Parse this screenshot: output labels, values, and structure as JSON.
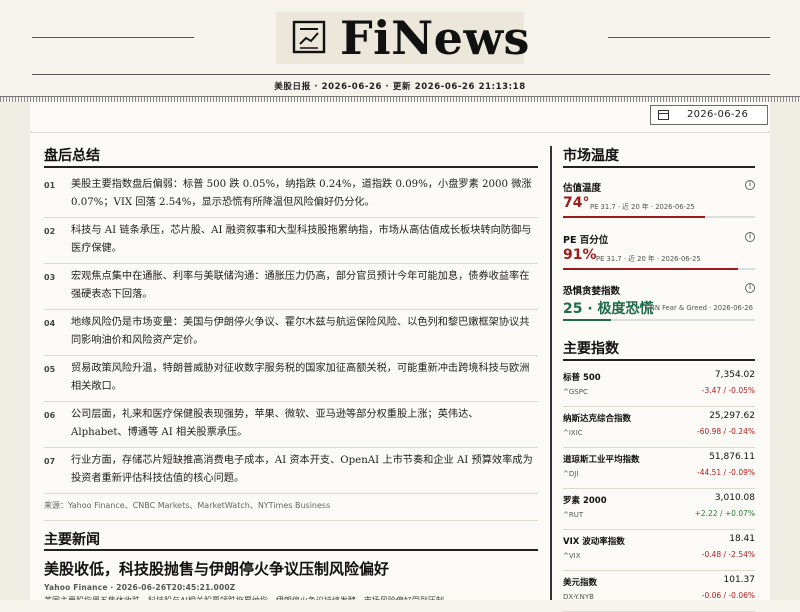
{
  "masthead": {
    "logo": "FiNews",
    "dateline": "美股日报 · 2026-06-26 · 更新 2026-06-26 21:13:18"
  },
  "date_picker": {
    "value": "2026-06-26"
  },
  "summary": {
    "title": "盘后总结",
    "items": [
      {
        "num": "01",
        "text": "美股主要指数盘后偏弱：标普 500 跌 0.05%，纳指跌 0.24%，道指跌 0.09%，小盘罗素 2000 微涨 0.07%；VIX 回落 2.54%，显示恐慌有所降温但风险偏好仍分化。"
      },
      {
        "num": "02",
        "text": "科技与 AI 链条承压，芯片股、AI 融资叙事和大型科技股拖累纳指，市场从高估值成长板块转向防御与医疗保健。"
      },
      {
        "num": "03",
        "text": "宏观焦点集中在通胀、利率与美联储沟通：通胀压力仍高，部分官员预计今年可能加息，债券收益率在强硬表态下回落。"
      },
      {
        "num": "04",
        "text": "地缘风险仍是市场变量：美国与伊朗停火争议、霍尔木兹与航运保险风险、以色列和黎巴嫩框架协议共同影响油价和风险资产定价。"
      },
      {
        "num": "05",
        "text": "贸易政策风险升温，特朗普威胁对征收数字服务税的国家加征高额关税，可能重新冲击跨境科技与欧洲相关敞口。"
      },
      {
        "num": "06",
        "text": "公司层面，礼来和医疗保健股表现强势，苹果、微软、亚马逊等部分权重股上涨；英伟达、Alphabet、博通等 AI 相关股票承压。"
      },
      {
        "num": "07",
        "text": "行业方面，存储芯片短缺推高消费电子成本，AI 资本开支、OpenAI 上市节奏和企业 AI 预算效率成为投资者重新评估科技估值的核心问题。"
      }
    ],
    "source": "来源：Yahoo Finance、CNBC Markets、MarketWatch、NYTimes Business"
  },
  "news": {
    "title": "主要新闻",
    "headline": "美股收低，科技股抛售与伊朗停火争议压制风险偏好",
    "meta": "Yahoo Finance · 2026-06-26T20:45:21.000Z",
    "snippet": "美国主要股指周五集体收跌，科技股与AI相关股票领跌拖累纳指，伊朗停火争议持续发酵，市场风险偏好受到压制。"
  },
  "temperature": {
    "title": "市场温度",
    "gauges": [
      {
        "label": "估值温度",
        "value": "74°",
        "sub": "PE 31.7 · 近 20 年 · 2026-06-25",
        "percent": 74,
        "color": "#9c1c1c"
      },
      {
        "label": "PE 百分位",
        "value": "91%",
        "sub": "PE 31.7 · 近 20 年 · 2026-06-25",
        "percent": 91,
        "color": "#9c1c1c"
      },
      {
        "label": "恐惧贪婪指数",
        "value": "25 · 极度恐慌",
        "sub": "CNN Fear & Greed · 2026-06-26",
        "percent": 25,
        "color": "#1f6b4a"
      }
    ]
  },
  "indices": {
    "title": "主要指数",
    "rows": [
      {
        "name": "标普 500",
        "symbol": "^GSPC",
        "price": "7,354.02",
        "change": "-3.47 / -0.05%",
        "dir": "neg"
      },
      {
        "name": "纳斯达克综合指数",
        "symbol": "^IXIC",
        "price": "25,297.62",
        "change": "-60.98 / -0.24%",
        "dir": "neg"
      },
      {
        "name": "道琼斯工业平均指数",
        "symbol": "^DJI",
        "price": "51,876.11",
        "change": "-44.51 / -0.09%",
        "dir": "neg"
      },
      {
        "name": "罗素 2000",
        "symbol": "^RUT",
        "price": "3,010.08",
        "change": "+2.22 / +0.07%",
        "dir": "pos"
      },
      {
        "name": "VIX 波动率指数",
        "symbol": "^VIX",
        "price": "18.41",
        "change": "-0.48 / -2.54%",
        "dir": "neg"
      },
      {
        "name": "美元指数",
        "symbol": "DX-Y.NYB",
        "price": "101.37",
        "change": "-0.06 / -0.06%",
        "dir": "neg"
      }
    ]
  }
}
